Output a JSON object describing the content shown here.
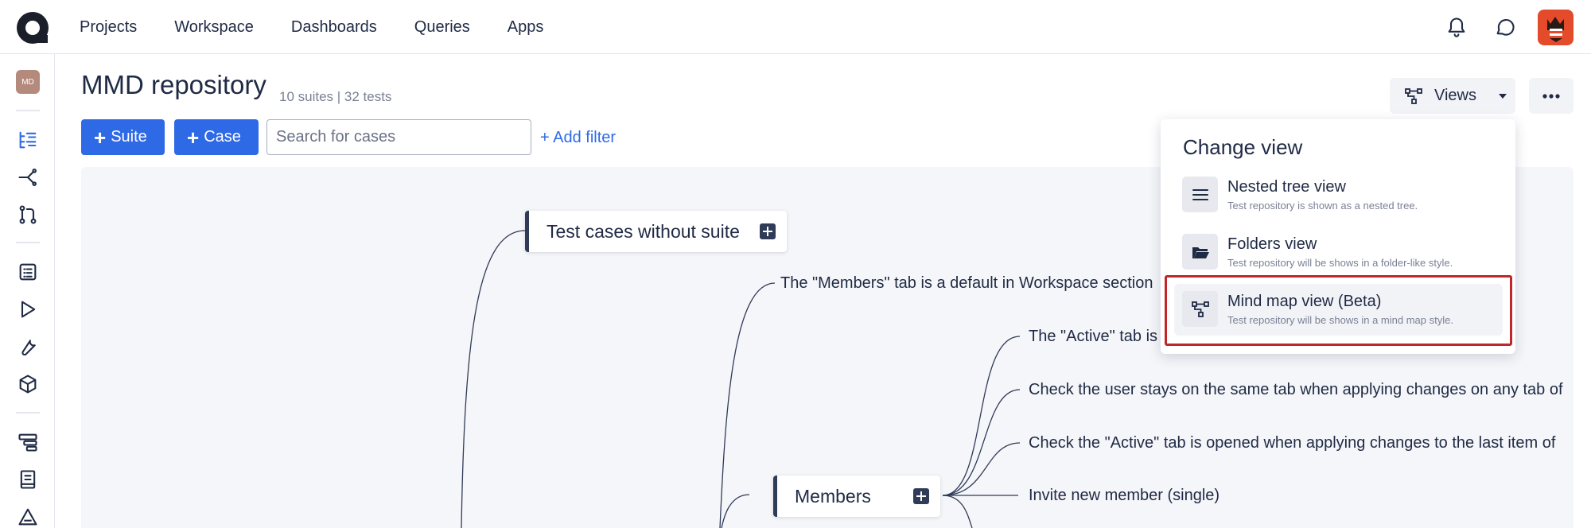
{
  "nav": {
    "links": [
      "Projects",
      "Workspace",
      "Dashboards",
      "Queries",
      "Apps"
    ]
  },
  "sidebar": {
    "project_initials": "MD"
  },
  "header": {
    "title": "MMD repository",
    "meta": "10 suites | 32 tests",
    "views_label": "Views"
  },
  "toolbar": {
    "suite_label": "Suite",
    "case_label": "Case",
    "search_placeholder": "Search for cases",
    "add_filter_label": "+ Add filter"
  },
  "mindmap": {
    "suite_nodes": [
      "Test cases without suite",
      "Members"
    ],
    "leaves": [
      "The \"Members\" tab is a default in Workspace section",
      "The \"Active\" tab is",
      "Check the user stays on the same tab when applying changes on any tab of",
      "Check the \"Active\" tab is opened when applying changes to the last item of",
      "Invite  new member (single)"
    ]
  },
  "dropdown": {
    "title": "Change view",
    "items": [
      {
        "name": "Nested tree view",
        "description": "Test repository is shown as a nested tree.",
        "icon": "list-icon",
        "selected": false
      },
      {
        "name": "Folders view",
        "description": "Test repository will be shows in a folder-like style.",
        "icon": "folder-icon",
        "selected": false
      },
      {
        "name": "Mind map view (Beta)",
        "description": "Test repository will be shows in a mind map style.",
        "icon": "mindmap-icon",
        "selected": true
      }
    ]
  },
  "colors": {
    "accent": "#2f6ae6",
    "highlight": "#c0262a",
    "node_border": "#2f3b57"
  }
}
